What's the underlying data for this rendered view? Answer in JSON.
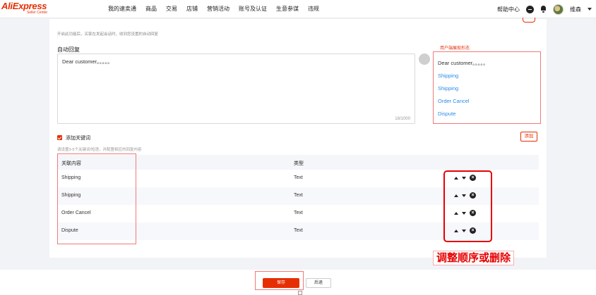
{
  "logo": {
    "brand": "AliExpress",
    "sub": "Seller Center"
  },
  "nav": {
    "items": [
      "我的速卖通",
      "商品",
      "交易",
      "店铺",
      "营销活动",
      "账号及认证",
      "生意参谋",
      "违规"
    ]
  },
  "header_right": {
    "help": "帮助中心",
    "user": "维森"
  },
  "form": {
    "tip": "开启此功能后，买家在发起会话时，收到您设置的自动回复",
    "auto_reply_label": "自动回复",
    "auto_reply_value": "Dear customer。。。。。",
    "counter": "18/1000"
  },
  "preview": {
    "title": "用户端展现形态",
    "greeting": "Dear customer。。。。。",
    "links": [
      "Shipping",
      "Shipping",
      "Order Cancel",
      "Dispute"
    ]
  },
  "keywords": {
    "checkbox_label": "添加关键词",
    "hint": "请设置3-5个关键词/短语，并配置相应的回复内容",
    "add_button": "添加",
    "columns": [
      "关联内容",
      "类型"
    ],
    "rows": [
      {
        "content": "Shipping",
        "type": "Text"
      },
      {
        "content": "Shipping",
        "type": "Text"
      },
      {
        "content": "Order Cancel",
        "type": "Text"
      },
      {
        "content": "Dispute",
        "type": "Text"
      }
    ]
  },
  "annotation": "调整顺序或删除",
  "footer": {
    "save": "保存",
    "back": "后退"
  },
  "colors": {
    "brand": "#e62e04",
    "link": "#2b8be8",
    "highlight": "#e60000"
  }
}
